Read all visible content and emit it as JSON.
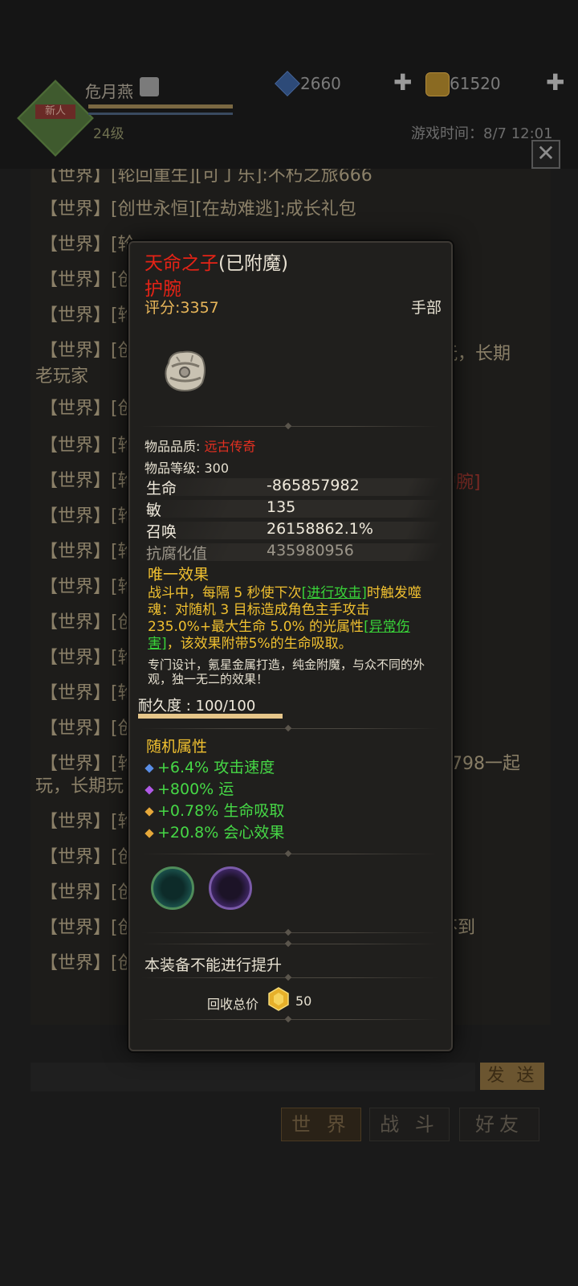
{
  "player": {
    "name": "危月燕",
    "level": "24级",
    "tag": "新人"
  },
  "currency": {
    "gem": "2660",
    "gold": "61520"
  },
  "game_time": "游戏时间：8/7 12:01",
  "chat": {
    "lines": [
      {
        "tag": "【世界】",
        "text": "[轮回重生][可丁乐]:不朽之旅666"
      },
      {
        "tag": "【世界】",
        "text": "[创世永恒][在劫难逃]:成长礼包"
      },
      {
        "tag": "【世界】",
        "text": "[轮"
      },
      {
        "tag": "【世界】",
        "text": "[创"
      },
      {
        "tag": "【世界】",
        "text": "[轮"
      },
      {
        "tag": "【世界】",
        "text": "[创"
      },
      {
        "tag": "【世界】",
        "text": "[创"
      },
      {
        "tag": "【世界】",
        "text": "[轮"
      },
      {
        "tag": "【世界】",
        "text": "[轮"
      },
      {
        "tag": "【世界】",
        "text": "[轮"
      },
      {
        "tag": "【世界】",
        "text": "[轮"
      },
      {
        "tag": "【世界】",
        "text": "[轮"
      },
      {
        "tag": "【世界】",
        "text": "[创"
      },
      {
        "tag": "【世界】",
        "text": "[轮"
      },
      {
        "tag": "【世界】",
        "text": "[轮"
      },
      {
        "tag": "【世界】",
        "text": "[创"
      },
      {
        "tag": "【世界】",
        "text": "[轮"
      },
      {
        "tag": "【世界】",
        "text": "[轮"
      },
      {
        "tag": "【世界】",
        "text": "[创"
      },
      {
        "tag": "【世界】",
        "text": "[创"
      },
      {
        "tag": "【世界】",
        "text": "[创"
      },
      {
        "tag": "【世界】",
        "text": "[创"
      }
    ],
    "wrap1_right": "玩，长期",
    "wrap1_next": "老玩家",
    "link_right": "护腕]",
    "wrap2_right": "0798一起",
    "wrap2_next": "玩，长期玩",
    "wrap3_right": "不到",
    "send_label": "发 送",
    "tabs": [
      "世 界",
      "战 斗",
      "好友"
    ]
  },
  "item": {
    "name": "天命之子",
    "enchant": "(已附魔)",
    "type": "护腕",
    "score": "评分:3357",
    "slot": "手部",
    "quality_label": "物品品质: ",
    "quality_value": "远古传奇",
    "level_label": "物品等级: 300",
    "stats": [
      {
        "k": "生命",
        "v": "-865857982"
      },
      {
        "k": "敏",
        "v": "135"
      },
      {
        "k": "召唤",
        "v": "26158862.1%"
      },
      {
        "k": "抗腐化值",
        "v": "435980956"
      }
    ],
    "unique_title": "唯一效果",
    "unique_p1": "战斗中，每隔 5 秒使下次",
    "unique_link1": "[进行攻击]",
    "unique_p2": "时触发噬魂：对随机 3 目标造成角色主手攻击235.0%+最大生命 5.0% 的光属性",
    "unique_link2": "[异常伤害]",
    "unique_p3": "，该效果附带5%的生命吸取。",
    "flavor": "专门设计，氪星金属打造，纯金附魔，与众不同的外观，独一无二的效果！",
    "durability_label": "耐久度 : 100/100",
    "durability_fraction": 1.0,
    "random_title": "随机属性",
    "random_attrs": [
      {
        "text": "+6.4% 攻击速度",
        "bullet_color": "#5a8ee6"
      },
      {
        "text": "+800% 运",
        "bullet_color": "#b05ae6"
      },
      {
        "text": "+0.78% 生命吸取",
        "bullet_color": "#e6a83a"
      },
      {
        "text": "+20.8% 会心效果",
        "bullet_color": "#e6a83a"
      }
    ],
    "no_upgrade": "本装备不能进行提升",
    "recycle_label": "回收总价",
    "recycle_value": "50"
  },
  "colors": {
    "legendary_red": "#e62316",
    "unique_gold": "#f0c030",
    "attr_green": "#46d846"
  }
}
